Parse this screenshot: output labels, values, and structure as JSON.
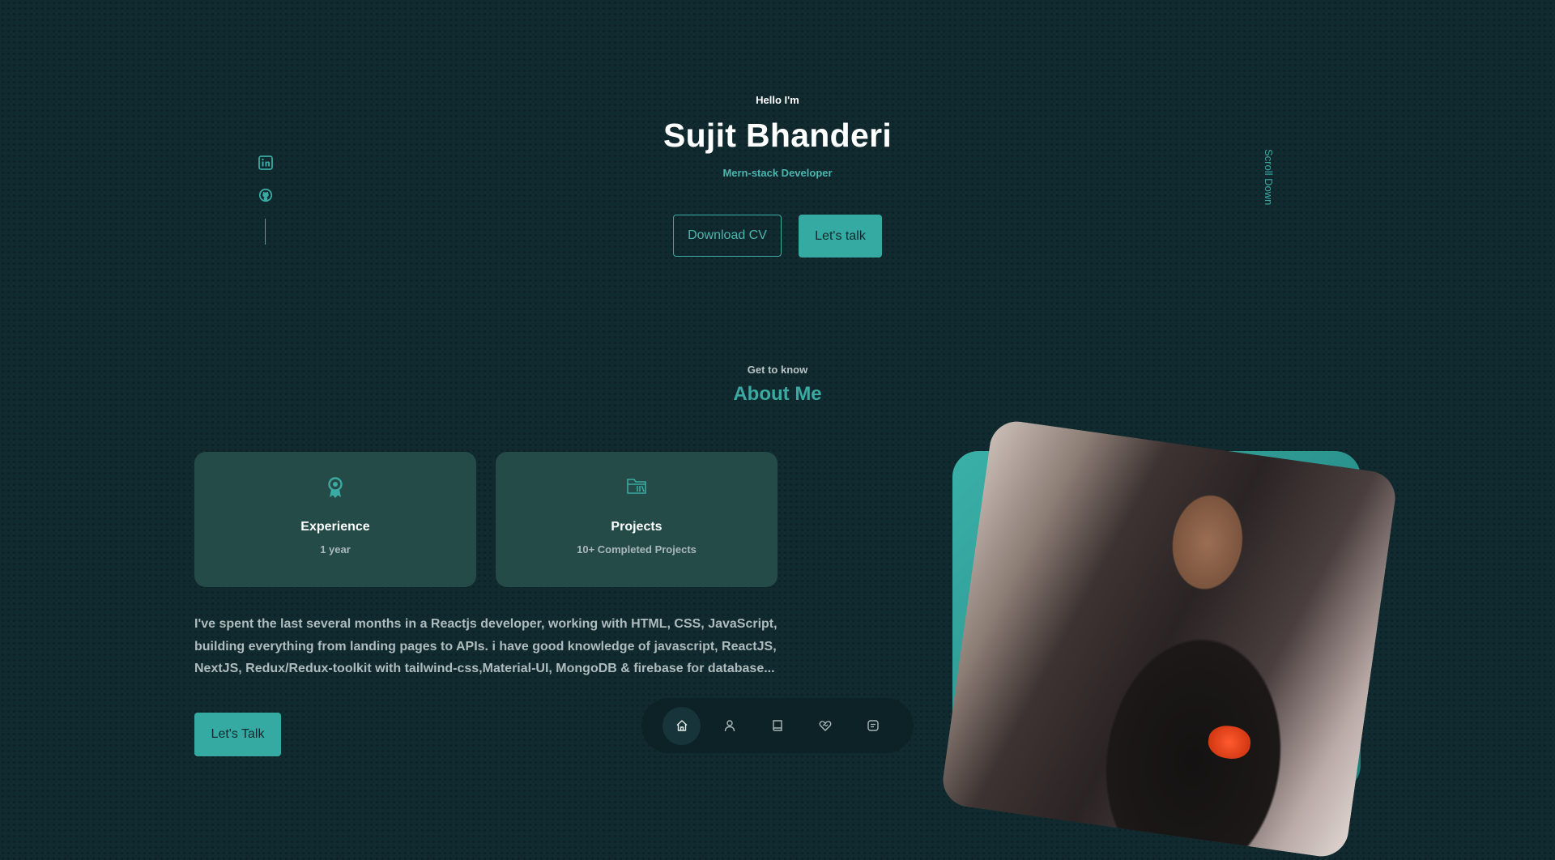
{
  "hero": {
    "greeting": "Hello I'm",
    "name": "Sujit Bhanderi",
    "role": "Mern-stack Developer",
    "download_cv_label": "Download CV",
    "lets_talk_label": "Let's talk"
  },
  "socials": [
    {
      "icon": "linkedin-icon"
    },
    {
      "icon": "github-icon"
    }
  ],
  "scroll_down_label": "Scroll Down",
  "about": {
    "subtitle": "Get to know",
    "title": "About Me",
    "cards": [
      {
        "icon": "award-icon",
        "title": "Experience",
        "value": "1 year"
      },
      {
        "icon": "folder-icon",
        "title": "Projects",
        "value": "10+ Completed Projects"
      }
    ],
    "bio": "I've spent the last several months in a Reactjs developer, working with HTML, CSS, JavaScript, building everything from landing pages to APIs. i have good knowledge of javascript, ReactJS, NextJS, Redux/Redux-toolkit with tailwind-css,Material-UI, MongoDB & firebase for database...",
    "cta_label": "Let's Talk"
  },
  "nav": {
    "items": [
      {
        "icon": "home-icon",
        "active": true
      },
      {
        "icon": "user-icon",
        "active": false
      },
      {
        "icon": "book-icon",
        "active": false
      },
      {
        "icon": "services-icon",
        "active": false
      },
      {
        "icon": "message-icon",
        "active": false
      }
    ]
  },
  "colors": {
    "background": "#112a30",
    "accent": "#35aaa3",
    "card": "#244b48",
    "text_muted": "#aebcbe"
  }
}
